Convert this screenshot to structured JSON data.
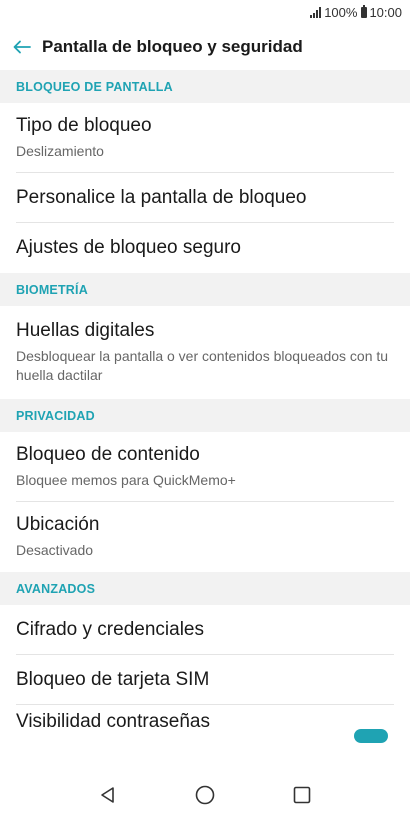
{
  "status": {
    "battery": "100%",
    "time": "10:00"
  },
  "header": {
    "title": "Pantalla de bloqueo y seguridad"
  },
  "sections": {
    "screen_lock": {
      "header": "BLOQUEO DE PANTALLA",
      "lock_type": {
        "title": "Tipo de bloqueo",
        "subtitle": "Deslizamiento"
      },
      "customize": {
        "title": "Personalice la pantalla de bloqueo"
      },
      "secure_lock": {
        "title": "Ajustes de bloqueo seguro"
      }
    },
    "biometrics": {
      "header": "BIOMETRÍA",
      "fingerprints": {
        "title": "Huellas digitales",
        "subtitle": "Desbloquear la pantalla o ver contenidos bloqueados con tu huella dactilar"
      }
    },
    "privacy": {
      "header": "PRIVACIDAD",
      "content_lock": {
        "title": "Bloqueo de contenido",
        "subtitle": "Bloquee memos para QuickMemo+"
      },
      "location": {
        "title": "Ubicación",
        "subtitle": "Desactivado"
      }
    },
    "advanced": {
      "header": "AVANZADOS",
      "encryption": {
        "title": "Cifrado y credenciales"
      },
      "sim_lock": {
        "title": "Bloqueo de tarjeta SIM"
      },
      "password_visibility": {
        "title": "Visibilidad contraseñas"
      }
    }
  },
  "colors": {
    "accent": "#1fa3b3",
    "section_bg": "#f2f2f2",
    "text_primary": "#1a1a1a",
    "text_secondary": "#666666"
  },
  "icons": {
    "back": "arrow-left-icon",
    "signal": "signal-icon",
    "battery": "battery-icon",
    "nav_back": "triangle-back-icon",
    "nav_home": "circle-home-icon",
    "nav_recents": "square-recents-icon"
  }
}
